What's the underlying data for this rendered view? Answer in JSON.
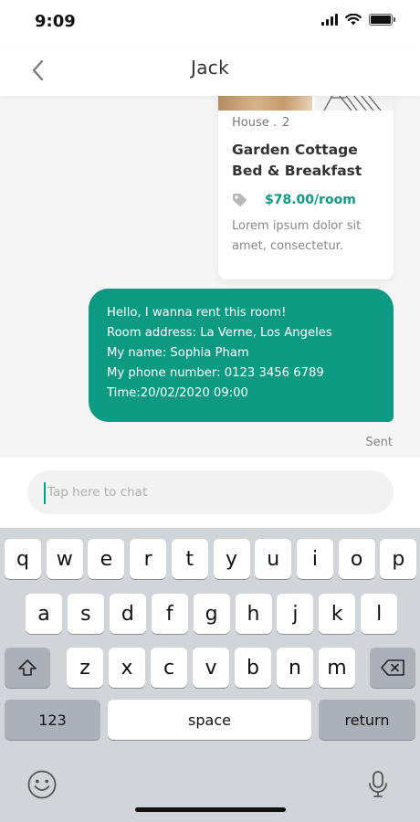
{
  "status_bar": {
    "time": "9:09"
  },
  "header": {
    "title": "Jack"
  },
  "listing_card": {
    "type": "House .",
    "count": "2",
    "title": "Garden Cottage Bed & Breakfast",
    "price": "$78.00/room",
    "description": "Lorem ipsum dolor sit amet, consectetur."
  },
  "message": {
    "lines": [
      "Hello, I wanna rent this room!",
      "Room address: La Verne, Los Angeles",
      "My name: Sophia Pham",
      "My phone number: 0123 3456 6789",
      "Time:20/02/2020 09:00"
    ],
    "status": "Sent"
  },
  "composer": {
    "placeholder": "Tap here to chat"
  },
  "keyboard": {
    "row1": [
      "q",
      "w",
      "e",
      "r",
      "t",
      "y",
      "u",
      "i",
      "o",
      "p"
    ],
    "row2": [
      "a",
      "s",
      "d",
      "f",
      "g",
      "h",
      "j",
      "k",
      "l"
    ],
    "row3": [
      "z",
      "x",
      "c",
      "v",
      "b",
      "n",
      "m"
    ],
    "numbers_label": "123",
    "space_label": "space",
    "return_label": "return"
  },
  "colors": {
    "accent": "#0d9a83",
    "background": "#f5f5f5",
    "keyboard": "#d1d4d9"
  }
}
